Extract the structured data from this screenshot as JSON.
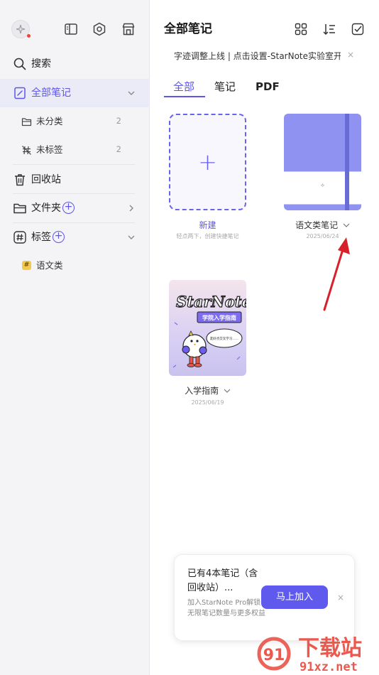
{
  "sidebar": {
    "search_label": "搜索",
    "all_notes_label": "全部笔记",
    "uncategorized": {
      "label": "未分类",
      "count": "2"
    },
    "untagged": {
      "label": "未标签",
      "count": "2"
    },
    "trash_label": "回收站",
    "folders_label": "文件夹",
    "tags_label": "标签",
    "tag_items": [
      {
        "label": "语文类",
        "chip": "#"
      }
    ]
  },
  "header": {
    "title": "全部笔记",
    "announcement": "字迹调整上线 | 点击设置-StarNote实验室开...",
    "close_glyph": "×"
  },
  "tabs": [
    {
      "label": "全部",
      "active": true
    },
    {
      "label": "笔记",
      "active": false
    },
    {
      "label": "PDF",
      "active": false
    }
  ],
  "cards": {
    "new": {
      "plus": "+",
      "title": "新建",
      "subtitle": "轻点两下，创建快捷笔记"
    },
    "items": [
      {
        "title": "语文类笔记",
        "date": "2025/06/24",
        "chevron": "⌄",
        "cover_color": "#8f92f0"
      },
      {
        "title": "入学指南",
        "date": "2025/06/19",
        "chevron": "⌄"
      }
    ]
  },
  "guide_cover": {
    "brand": "StarNote",
    "ribbon": "学院入学指南",
    "bubble": "友好点交叉学习……"
  },
  "banner": {
    "title": "已有4本笔记（含回收站）...",
    "description": "加入StarNote Pro解锁无限笔记数量与更多权益",
    "button_label": "马上加入",
    "close_glyph": "×"
  },
  "watermark": {
    "text_main": "下载站",
    "text_url": "91xz.net",
    "logo_digits": "91"
  },
  "colors": {
    "accent": "#5d56e8",
    "sidebar_bg": "#f4f4f6",
    "notebook": "#8f92f0",
    "annotation_arrow": "#d8202a"
  }
}
